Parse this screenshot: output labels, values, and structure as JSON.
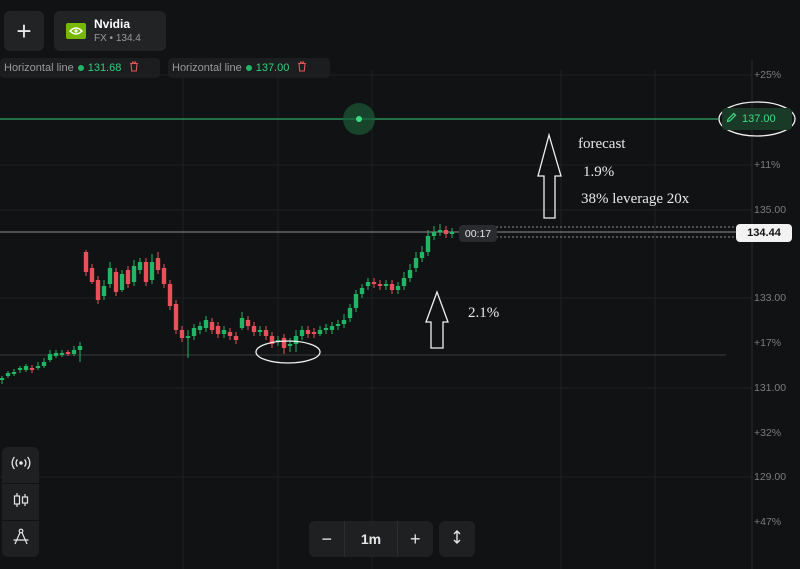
{
  "toolbar": {
    "add_icon": "plus-icon",
    "asset": {
      "name": "Nvidia",
      "subtitle": "FX • 134.4",
      "logo_icon": "nvidia-logo-icon"
    }
  },
  "horizontal_lines": [
    {
      "label": "Horizontal line",
      "value": "131.68",
      "delete_icon": "trash-icon"
    },
    {
      "label": "Horizontal line",
      "value": "137.00",
      "delete_icon": "trash-icon"
    }
  ],
  "price_scale": {
    "ticks": [
      "+25%",
      "+11%",
      "135.00",
      "133.00",
      "+17%",
      "131.00",
      "+32%",
      "129.00",
      "+47%"
    ],
    "target_line_label": "137.00",
    "current_price": "134.44",
    "countdown": "00:17",
    "edit_icon": "pencil-icon"
  },
  "annotations": {
    "forecast": "forecast",
    "pct1": "1.9%",
    "leverage": "38% leverage 20x",
    "pct2": "2.1%"
  },
  "bottom_controls": {
    "minus": "−",
    "timeframe": "1m",
    "plus": "+",
    "resize_icon": "vertical-resize-icon"
  },
  "side_tools": [
    "broadcast-icon",
    "candles-icon",
    "drawing-compass-icon"
  ],
  "colors": {
    "up": "#22b566",
    "down": "#e8515a",
    "line": "#2fa868",
    "background": "#111213"
  }
}
